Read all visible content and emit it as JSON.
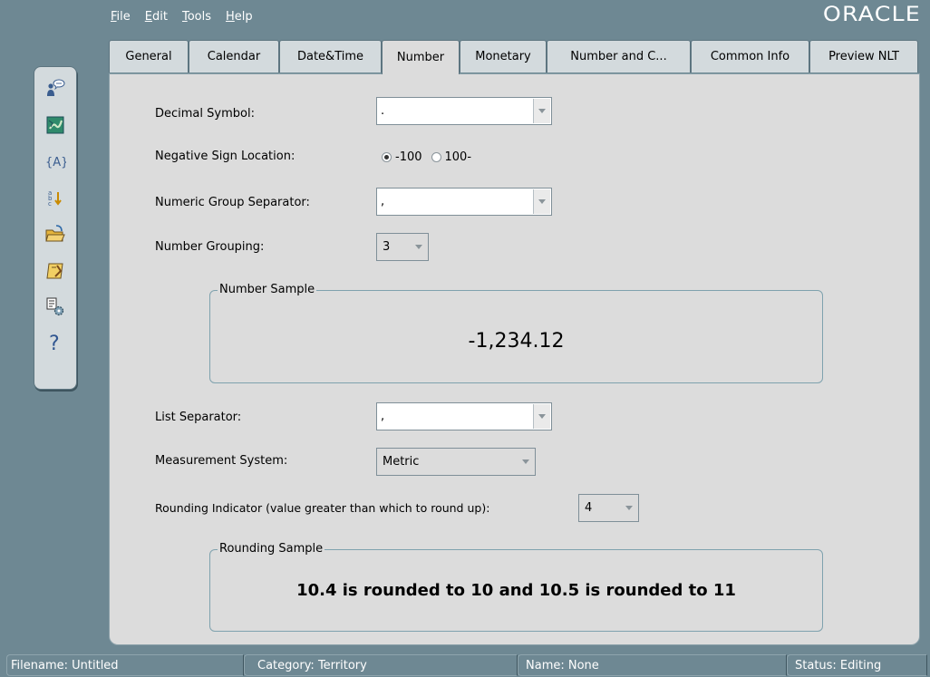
{
  "menu": [
    {
      "mnemonic": "F",
      "rest": "ile"
    },
    {
      "mnemonic": "E",
      "rest": "dit"
    },
    {
      "mnemonic": "T",
      "rest": "ools"
    },
    {
      "mnemonic": "H",
      "rest": "elp"
    }
  ],
  "brand": {
    "logo_text": "ORACLE"
  },
  "tabs": [
    "General",
    "Calendar",
    "Date&Time",
    "Number",
    "Monetary",
    "Number and C...",
    "Common Info",
    "Preview NLT"
  ],
  "active_tab": "Number",
  "form": {
    "decimal_symbol": {
      "label": "Decimal Symbol:",
      "value": "."
    },
    "negative_sign": {
      "label": "Negative Sign Location:",
      "option1": "-100",
      "option2": "100-",
      "selected": "-100"
    },
    "group_separator": {
      "label": "Numeric Group Separator:",
      "value": ","
    },
    "number_grouping": {
      "label": "Number Grouping:",
      "value": "3"
    },
    "number_sample": {
      "title": "Number Sample",
      "value": "-1,234.12"
    },
    "list_separator": {
      "label": "List Separator:",
      "value": ","
    },
    "measurement": {
      "label": "Measurement System:",
      "value": "Metric"
    },
    "rounding": {
      "label": "Rounding Indicator (value greater than which to round up):",
      "value": "4"
    },
    "rounding_sample": {
      "title": "Rounding Sample",
      "value": "10.4 is rounded to 10 and 10.5 is rounded to 11"
    }
  },
  "status": {
    "filename": "Filename: Untitled",
    "category": "Category: Territory",
    "name": "Name: None",
    "state": "Status: Editing"
  },
  "toolbar_icons": [
    "users-search-icon",
    "map-icon",
    "variable-icon",
    "sort-icon",
    "open-folder-icon",
    "save-icon",
    "settings-icon",
    "help-icon"
  ],
  "colors": {
    "background": "#6e8893",
    "panel": "#dcdcdc",
    "accent": "#7fa2ae"
  }
}
